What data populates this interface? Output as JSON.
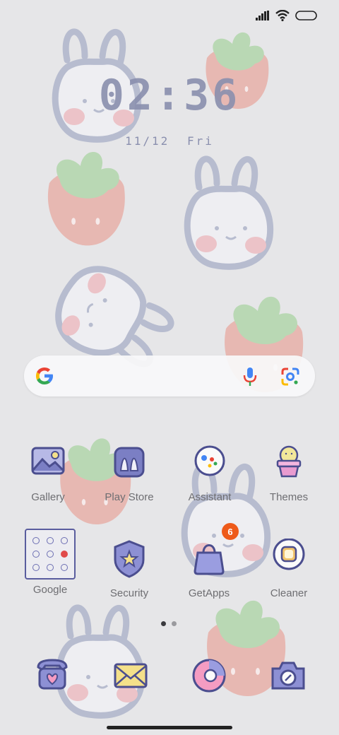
{
  "clock": {
    "hour": "02",
    "minute": "36",
    "separator": ":"
  },
  "date": {
    "day": "11/12",
    "weekday": "Fri"
  },
  "status": {
    "signal_icon": "signal-icon",
    "wifi_icon": "wifi-icon",
    "battery_icon": "battery-icon"
  },
  "search": {
    "logo": "google-g-icon",
    "mic_icon": "mic-icon",
    "lens_icon": "lens-icon"
  },
  "apps": [
    {
      "label": "Gallery"
    },
    {
      "label": "Play Store"
    },
    {
      "label": "Assistant"
    },
    {
      "label": "Themes"
    },
    {
      "label": "Google"
    },
    {
      "label": "Security"
    },
    {
      "label": "GetApps",
      "badge": "6"
    },
    {
      "label": "Cleaner"
    }
  ],
  "dock": [
    "phone-icon",
    "messages-icon",
    "browser-icon",
    "camera-icon"
  ],
  "pager": {
    "pages": 2,
    "active": 1
  },
  "colors": {
    "accent": "#7b7fc4",
    "outline": "#4b4e8f",
    "badge": "#ee5a1a"
  }
}
